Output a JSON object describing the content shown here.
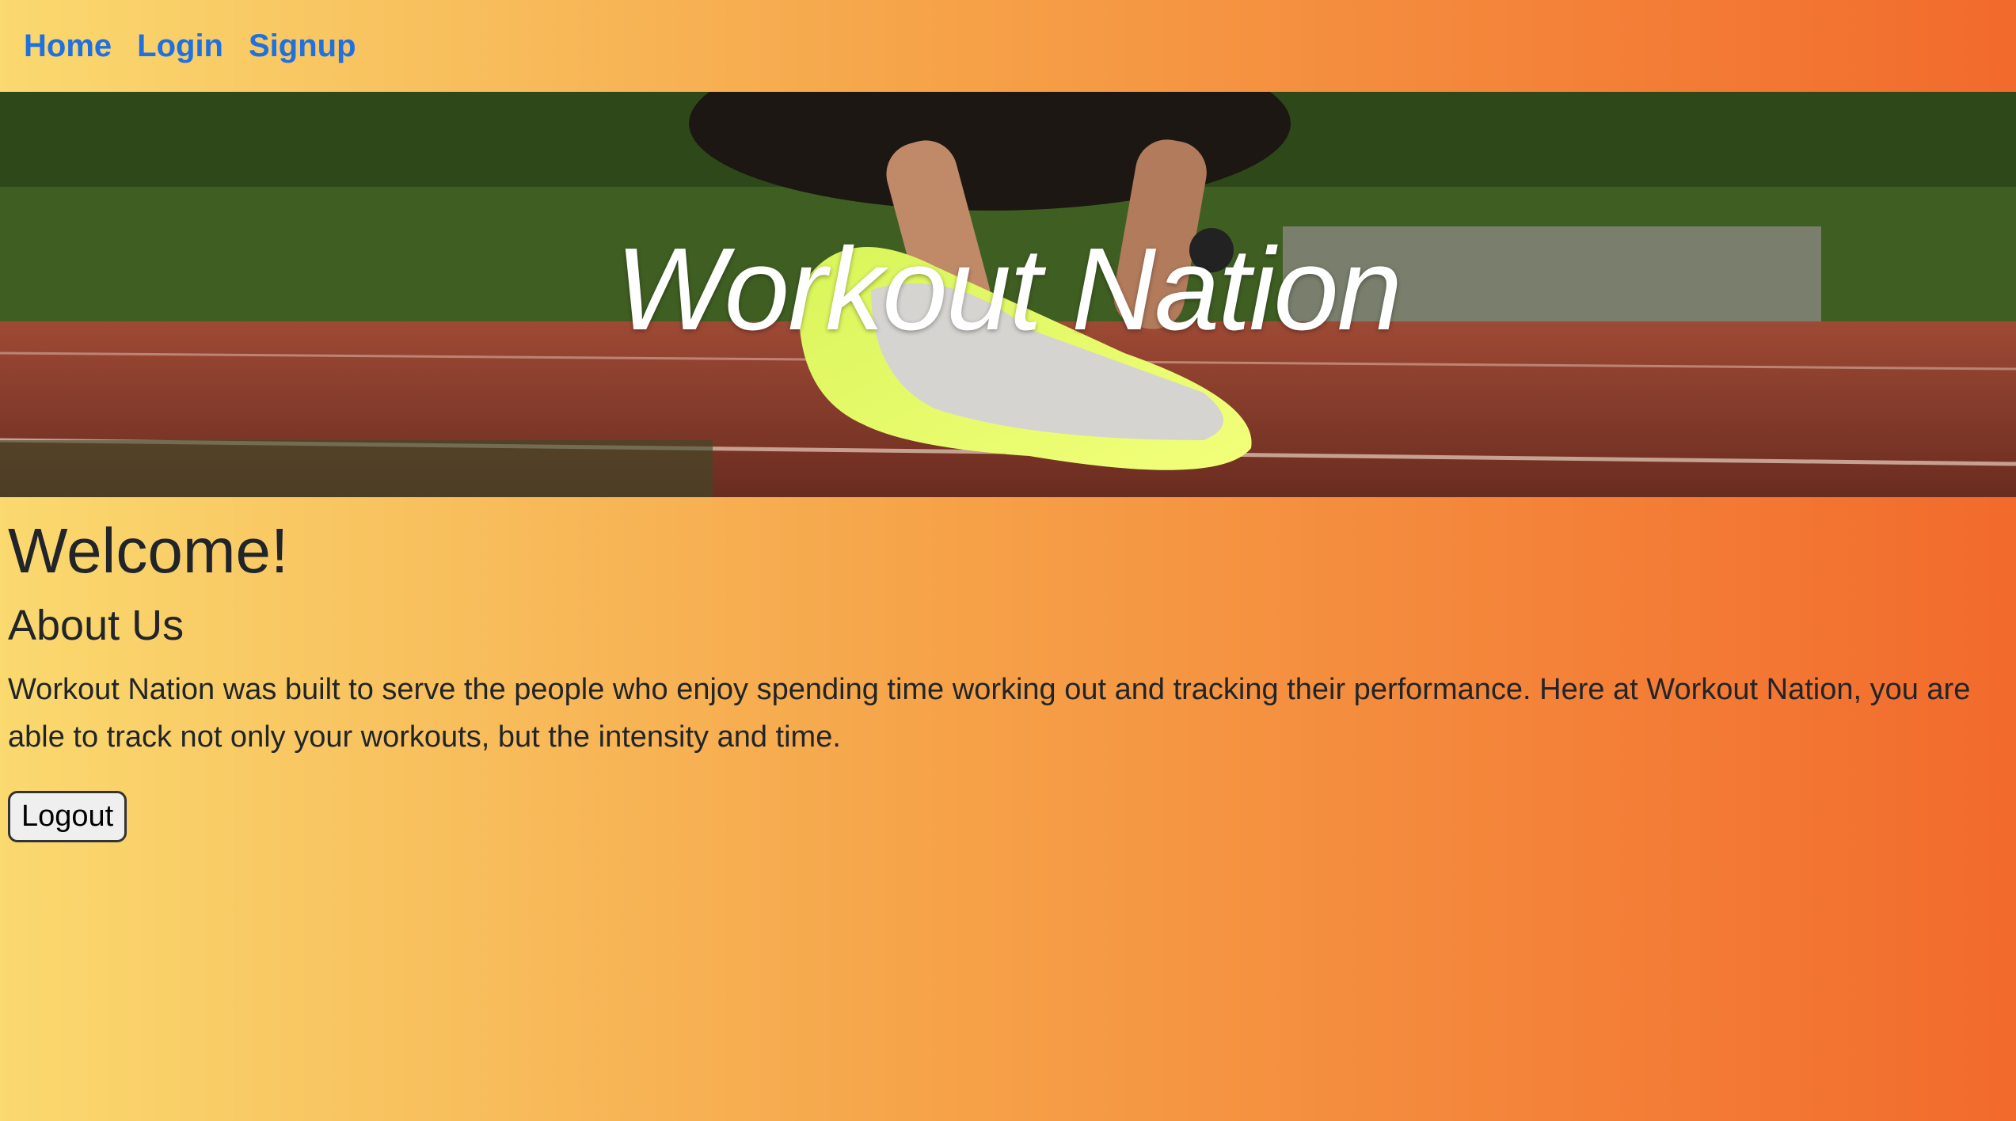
{
  "nav": {
    "items": [
      {
        "label": "Home"
      },
      {
        "label": "Login"
      },
      {
        "label": "Signup"
      }
    ],
    "link_color": "#1f70e0"
  },
  "hero": {
    "title": "Workout Nation",
    "image": "runner-tying-shoe-on-track"
  },
  "main": {
    "welcome": "Welcome!",
    "about_heading": "About Us",
    "about_text": "Workout Nation was built to serve the people who enjoy spending time working out and tracking their performance. Here at Workout Nation, you are able to track not only your workouts, but the intensity and time.",
    "logout_label": "Logout"
  },
  "colors": {
    "gradient_start": "#fad96f",
    "gradient_end": "#f26a2c"
  }
}
